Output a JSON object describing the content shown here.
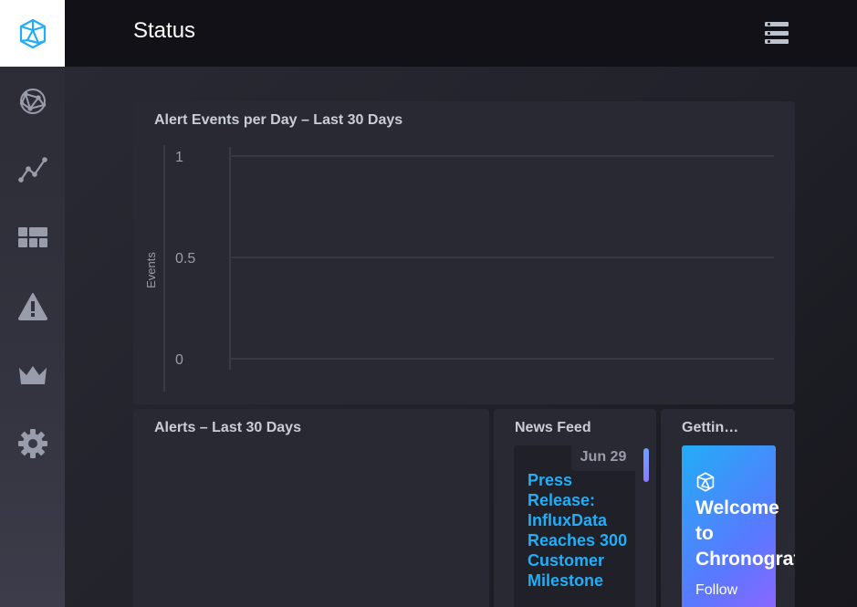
{
  "header": {
    "title": "Status"
  },
  "sidebar": {
    "items": [
      {
        "icon": "hexagon-logo-icon"
      },
      {
        "icon": "network-graph-icon"
      },
      {
        "icon": "line-graph-icon"
      },
      {
        "icon": "dashboard-grid-icon"
      },
      {
        "icon": "alert-triangle-icon"
      },
      {
        "icon": "crown-icon"
      },
      {
        "icon": "gear-icon"
      }
    ]
  },
  "panels": {
    "chart": {
      "title": "Alert Events per Day – Last 30 Days"
    },
    "alerts": {
      "title": "Alerts – Last 30 Days"
    },
    "news": {
      "title": "News Feed",
      "items": [
        {
          "date": "Jun 29",
          "headline": "Press Release: InfluxData Reaches 300 Customer Milestone"
        }
      ]
    },
    "getting_started": {
      "title": "Gettin…",
      "welcome_title": "Welcome\nto\nChronograf",
      "follow": "Follow"
    }
  },
  "chart_data": {
    "type": "line",
    "title": "Alert Events per Day – Last 30 Days",
    "ylabel": "Events",
    "xlabel": "",
    "ylim": [
      0,
      1
    ],
    "yticks": [
      "1",
      "0.5",
      "0"
    ],
    "series": [],
    "grid": true
  },
  "colors": {
    "accent": "#22adf6",
    "panel": "#292933",
    "topbar": "#111117"
  }
}
